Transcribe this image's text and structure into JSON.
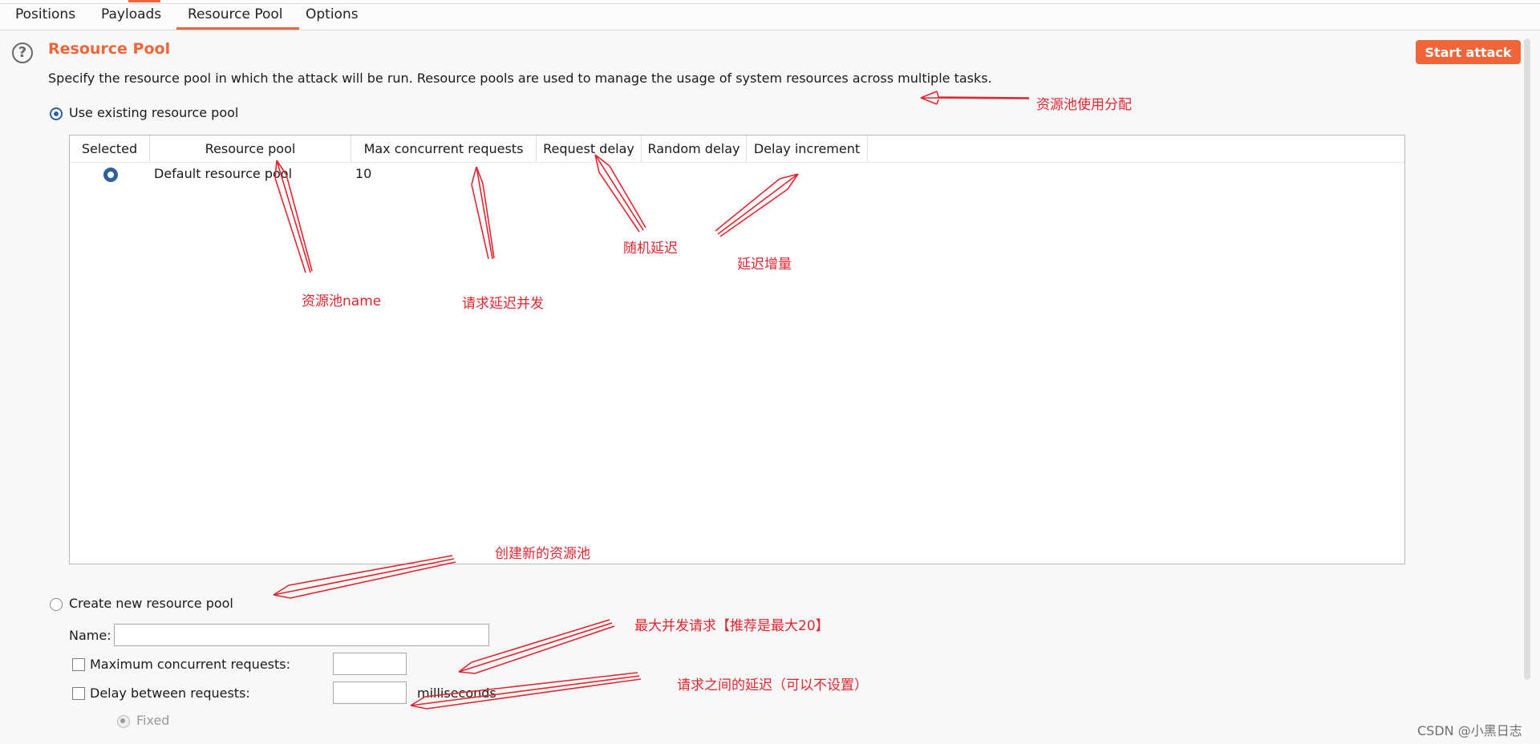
{
  "tabs": [
    "Positions",
    "Payloads",
    "Resource Pool",
    "Options"
  ],
  "active_tab": "Resource Pool",
  "section": {
    "title": "Resource Pool",
    "description": "Specify the resource pool in which the attack will be run. Resource pools are used to manage the usage of system resources across multiple tasks."
  },
  "start_attack_label": "Start attack",
  "use_existing_label": "Use existing resource pool",
  "table": {
    "columns": [
      "Selected",
      "Resource pool",
      "Max concurrent requests",
      "Request delay",
      "Random delay",
      "Delay increment"
    ],
    "rows": [
      {
        "selected": true,
        "resource_pool": "Default resource pool",
        "max_concurrent": "10",
        "request_delay": "",
        "random_delay": "",
        "delay_increment": ""
      }
    ]
  },
  "create_new_label": "Create new resource pool",
  "name_label": "Name:",
  "name_value": "",
  "max_concurrent_label": "Maximum concurrent requests:",
  "max_concurrent_value": "",
  "delay_between_label": "Delay between requests:",
  "delay_between_value": "",
  "milliseconds_label": "milliseconds",
  "fixed_label": "Fixed",
  "annotations": {
    "resource_pool_alloc": "资源池使用分配",
    "pool_name": "资源池name",
    "request_concurrency": "请求延迟并发",
    "random_delay": "随机延迟",
    "delay_increment": "延迟增量",
    "create_new_pool": "创建新的资源池",
    "max_concurrent": "最大并发请求【推荐是最大20】",
    "delay_between": "请求之间的延迟（可以不设置）"
  },
  "watermark": "CSDN @小黑日志",
  "colors": {
    "accent": "#f0663a",
    "radio": "#2e5f9e",
    "annotation": "#e0262f"
  }
}
